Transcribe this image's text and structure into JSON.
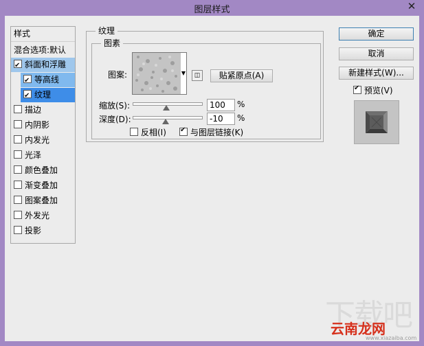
{
  "window": {
    "title": "图层样式",
    "close_label": "✕"
  },
  "sidebar": {
    "header": "样式",
    "items": [
      {
        "label": "混合选项:默认",
        "checkbox": false
      },
      {
        "label": "斜面和浮雕",
        "checkbox": true,
        "checked": true
      },
      {
        "label": "等高线",
        "checkbox": true,
        "checked": true
      },
      {
        "label": "纹理",
        "checkbox": true,
        "checked": true
      },
      {
        "label": "描边",
        "checkbox": true,
        "checked": false
      },
      {
        "label": "内阴影",
        "checkbox": true,
        "checked": false
      },
      {
        "label": "内发光",
        "checkbox": true,
        "checked": false
      },
      {
        "label": "光泽",
        "checkbox": true,
        "checked": false
      },
      {
        "label": "颜色叠加",
        "checkbox": true,
        "checked": false
      },
      {
        "label": "渐变叠加",
        "checkbox": true,
        "checked": false
      },
      {
        "label": "图案叠加",
        "checkbox": true,
        "checked": false
      },
      {
        "label": "外发光",
        "checkbox": true,
        "checked": false
      },
      {
        "label": "投影",
        "checkbox": true,
        "checked": false
      }
    ]
  },
  "texture": {
    "group_title": "纹理",
    "subgroup_title": "图素",
    "pattern_label": "图案:",
    "snap_button": "贴紧原点(A)",
    "scale_label": "缩放(S):",
    "scale_value": "100",
    "depth_label": "深度(D):",
    "depth_value": "-10",
    "percent": "%",
    "scale_level": 1.0,
    "depth_level": -0.1,
    "invert_label": "反相(I)",
    "invert_checked": false,
    "link_label": "与图层链接(K)",
    "link_checked": true
  },
  "buttons": {
    "ok": "确定",
    "cancel": "取消",
    "new_style": "新建样式(W)...",
    "preview_label": "预览(V)",
    "preview_checked": true
  },
  "watermark": {
    "text_big": "下载吧",
    "text_brand": "云南龙网",
    "text_url": "www.xiazaiba.com"
  }
}
